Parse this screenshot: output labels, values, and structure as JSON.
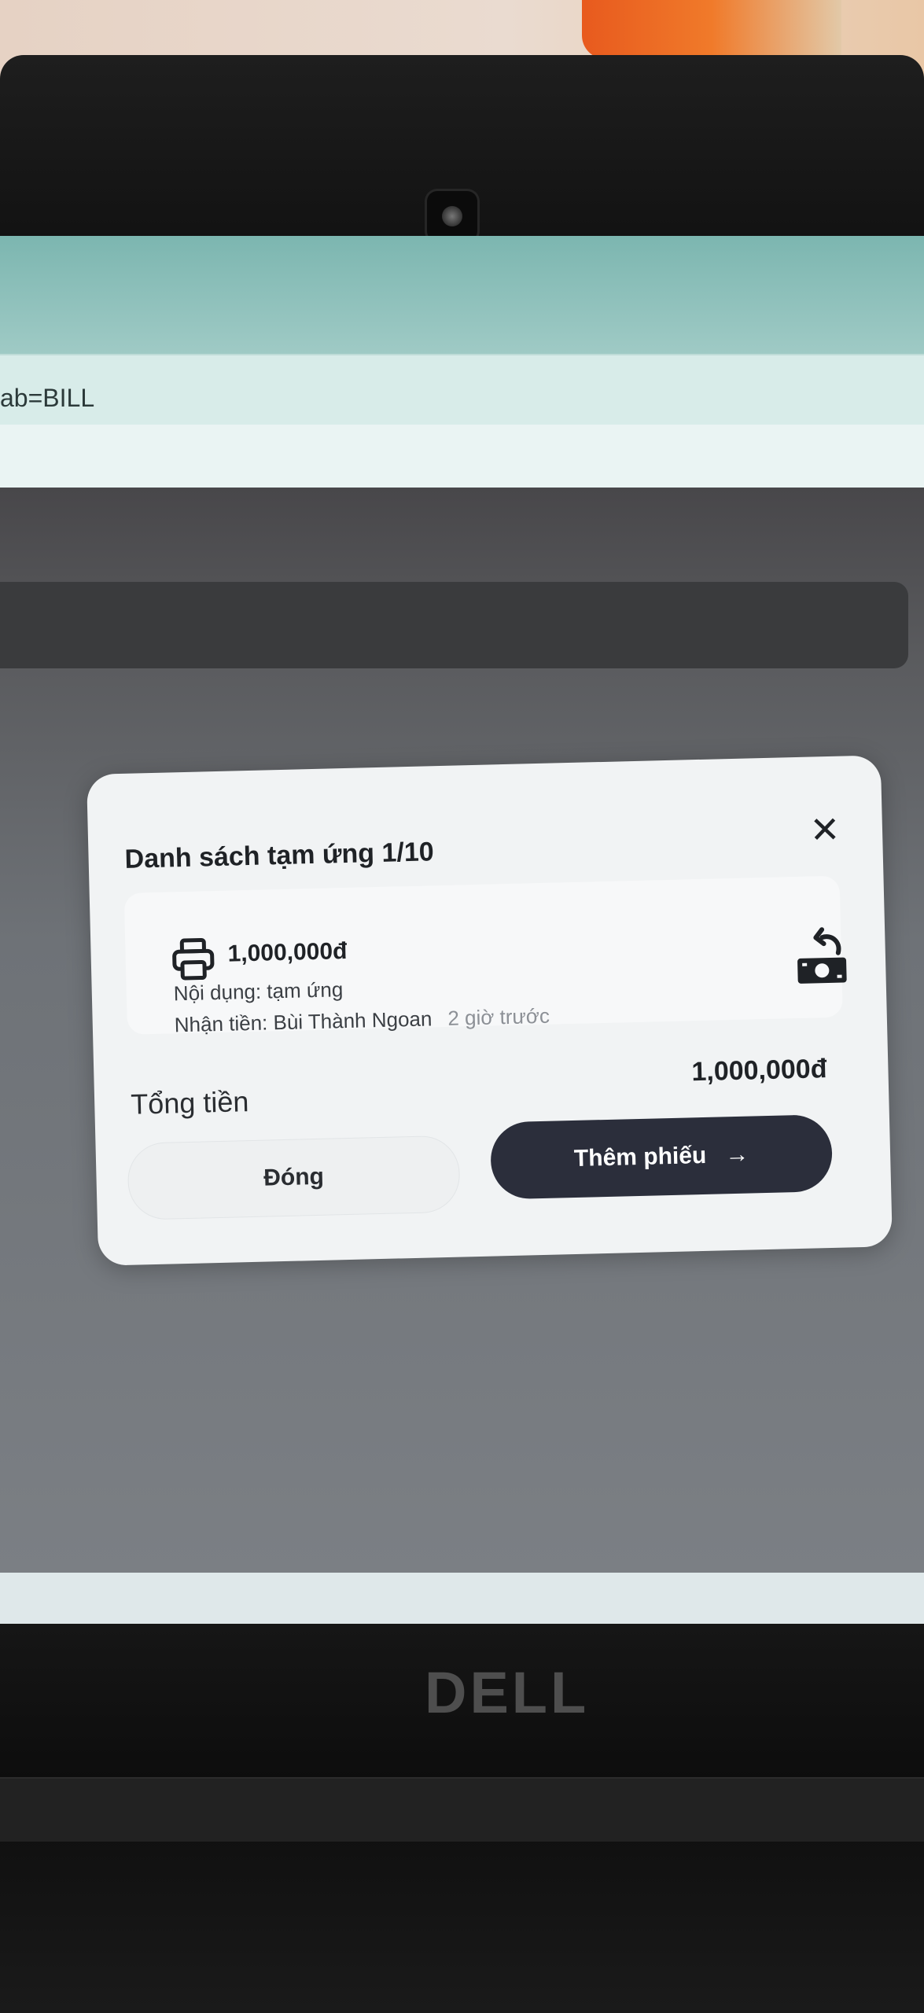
{
  "browser": {
    "address_fragment": "ab=BILL"
  },
  "modal": {
    "title": "Danh sách tạm ứng 1/10",
    "close_icon": "close-icon",
    "item": {
      "amount": "1,000,000đ",
      "content": "Nội dụng: tạm ứng",
      "receiver": "Nhận tiền: Bùi Thành Ngoan",
      "time_ago": "2 giờ trước",
      "left_icon": "printer-icon",
      "right_icon": "cash-refund-icon"
    },
    "total_label": "Tổng tiền",
    "total_value": "1,000,000đ",
    "close_button_label": "Đóng",
    "add_button_label": "Thêm phiếu",
    "add_button_icon": "arrow-right-icon"
  },
  "device": {
    "brand": "DELL"
  },
  "colors": {
    "primary_button": "#2b2e3b",
    "modal_bg": "#f1f3f4",
    "browser_tab_bar": "#7cb6b0"
  }
}
